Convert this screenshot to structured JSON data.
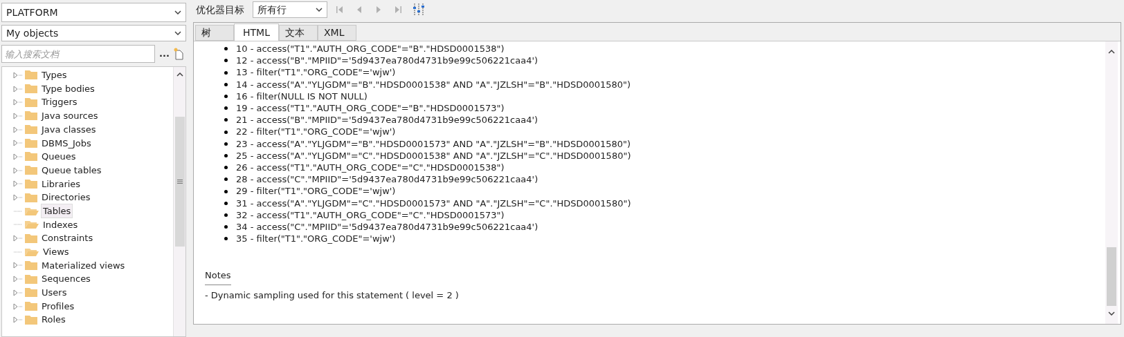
{
  "sidebar": {
    "schema_select": {
      "value": "PLATFORM"
    },
    "filter_select": {
      "value": "My objects"
    },
    "search": {
      "placeholder": "输入搜索文档"
    },
    "more_button": "...",
    "tree": [
      {
        "label": "Types",
        "expandable": true,
        "selected": false
      },
      {
        "label": "Type bodies",
        "expandable": true,
        "selected": false
      },
      {
        "label": "Triggers",
        "expandable": true,
        "selected": false
      },
      {
        "label": "Java sources",
        "expandable": true,
        "selected": false
      },
      {
        "label": "Java classes",
        "expandable": true,
        "selected": false
      },
      {
        "label": "DBMS_Jobs",
        "expandable": true,
        "selected": false
      },
      {
        "label": "Queues",
        "expandable": true,
        "selected": false
      },
      {
        "label": "Queue tables",
        "expandable": true,
        "selected": false
      },
      {
        "label": "Libraries",
        "expandable": true,
        "selected": false
      },
      {
        "label": "Directories",
        "expandable": true,
        "selected": false
      },
      {
        "label": "Tables",
        "expandable": false,
        "selected": true
      },
      {
        "label": "Indexes",
        "expandable": false,
        "selected": false
      },
      {
        "label": "Constraints",
        "expandable": true,
        "selected": false
      },
      {
        "label": "Views",
        "expandable": false,
        "selected": false
      },
      {
        "label": "Materialized views",
        "expandable": true,
        "selected": false
      },
      {
        "label": "Sequences",
        "expandable": true,
        "selected": false
      },
      {
        "label": "Users",
        "expandable": true,
        "selected": false
      },
      {
        "label": "Profiles",
        "expandable": true,
        "selected": false
      },
      {
        "label": "Roles",
        "expandable": true,
        "selected": false
      }
    ]
  },
  "toolbar": {
    "label": "优化器目标",
    "goal_select": {
      "value": "所有行"
    }
  },
  "tabs": [
    {
      "label": "树",
      "selected": false
    },
    {
      "label": "HTML",
      "selected": true
    },
    {
      "label": "文本",
      "selected": false
    },
    {
      "label": "XML",
      "selected": false
    }
  ],
  "predicates": [
    "10 - access(\"T1\".\"AUTH_ORG_CODE\"=\"B\".\"HDSD0001538\")",
    "12 - access(\"B\".\"MPIID\"='5d9437ea780d4731b9e99c506221caa4')",
    "13 - filter(\"T1\".\"ORG_CODE\"='wjw')",
    "14 - access(\"A\".\"YLJGDM\"=\"B\".\"HDSD0001538\" AND \"A\".\"JZLSH\"=\"B\".\"HDSD0001580\")",
    "16 - filter(NULL IS NOT NULL)",
    "19 - access(\"T1\".\"AUTH_ORG_CODE\"=\"B\".\"HDSD0001573\")",
    "21 - access(\"B\".\"MPIID\"='5d9437ea780d4731b9e99c506221caa4')",
    "22 - filter(\"T1\".\"ORG_CODE\"='wjw')",
    "23 - access(\"A\".\"YLJGDM\"=\"B\".\"HDSD0001573\" AND \"A\".\"JZLSH\"=\"B\".\"HDSD0001580\")",
    "25 - access(\"A\".\"YLJGDM\"=\"C\".\"HDSD0001538\" AND \"A\".\"JZLSH\"=\"C\".\"HDSD0001580\")",
    "26 - access(\"T1\".\"AUTH_ORG_CODE\"=\"C\".\"HDSD0001538\")",
    "28 - access(\"C\".\"MPIID\"='5d9437ea780d4731b9e99c506221caa4')",
    "29 - filter(\"T1\".\"ORG_CODE\"='wjw')",
    "31 - access(\"A\".\"YLJGDM\"=\"C\".\"HDSD0001573\" AND \"A\".\"JZLSH\"=\"C\".\"HDSD0001580\")",
    "32 - access(\"T1\".\"AUTH_ORG_CODE\"=\"C\".\"HDSD0001573\")",
    "34 - access(\"C\".\"MPIID\"='5d9437ea780d4731b9e99c506221caa4')",
    "35 - filter(\"T1\".\"ORG_CODE\"='wjw')"
  ],
  "notes": {
    "heading": "Notes",
    "text": "- Dynamic sampling used for this statement ( level = 2 )"
  }
}
